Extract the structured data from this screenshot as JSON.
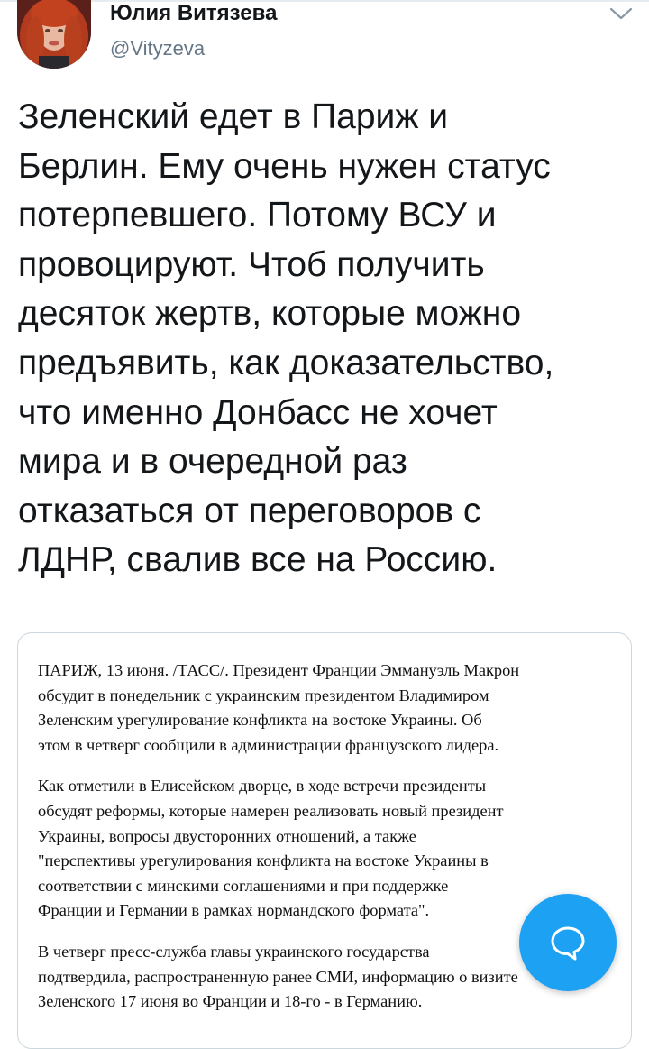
{
  "author": {
    "name": "Юлия Витязева",
    "handle": "@Vityzeva"
  },
  "icons": {
    "menu": "chevron-down-icon",
    "compose": "speech-bubble-icon"
  },
  "tweet": {
    "text": "Зеленский едет в Париж и\nБерлин. Ему очень нужен статус\nпотерпевшего. Потому ВСУ и\nпровоцируют. Чтоб получить\nдесяток жертв, которые можно\nпредъявить, как доказательство,\nчто именно Донбасс не хочет\nмира и в очередной раз\nотказаться от переговоров с\nЛДНР, свалив все на Россию."
  },
  "article": {
    "paragraphs": [
      "ПАРИЖ, 13 июня. /ТАСС/. Президент Франции Эммануэль Макрон\nобсудит в понедельник с украинским президентом Владимиром\nЗеленским урегулирование конфликта на востоке Украины. Об\nэтом в четверг сообщили в администрации французского лидера.",
      "Как отметили в Елисейском дворце, в ходе встречи президенты\nобсудят реформы, которые намерен реализовать новый президент\nУкраины, вопросы двусторонних отношений, а также\n\"перспективы урегулирования конфликта на востоке Украины в\nсоответствии с минскими соглашениями и при поддержке\nФранции и Германии в рамках нормандского формата\".",
      "В четверг пресс-служба главы украинского государства\nподтвердила, распространенную ранее СМИ, информацию о визите\nЗеленского 17 июня во Франции и 18-го - в Германию."
    ]
  },
  "colors": {
    "accent": "#1da1f2",
    "text": "#14171a",
    "secondary": "#657786",
    "border": "#ccd6dd"
  }
}
